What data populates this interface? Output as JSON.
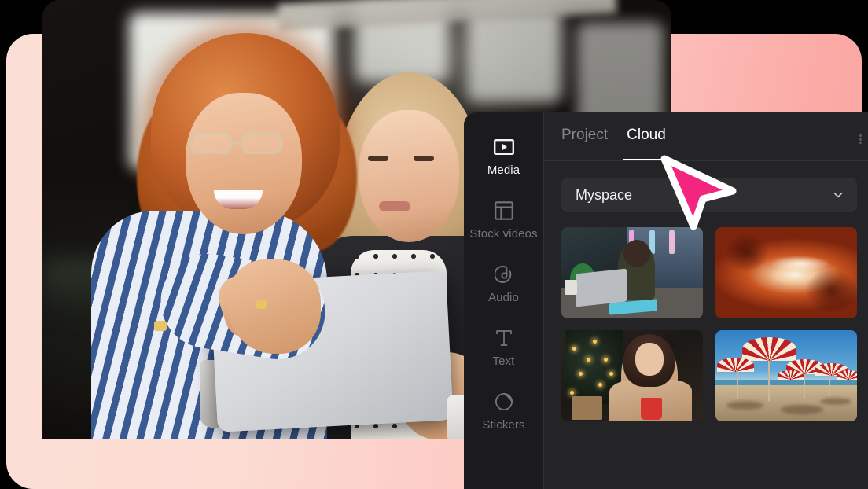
{
  "app": {
    "panel_title": "Media library panel"
  },
  "sidebar": {
    "items": [
      {
        "label": "Media",
        "icon": "media-play-rectangle-icon",
        "active": true
      },
      {
        "label": "Stock videos",
        "icon": "layout-grid-icon",
        "active": false
      },
      {
        "label": "Audio",
        "icon": "audio-note-circle-icon",
        "active": false
      },
      {
        "label": "Text",
        "icon": "text-serif-t-icon",
        "active": false
      },
      {
        "label": "Stickers",
        "icon": "sticker-circle-icon",
        "active": false
      }
    ]
  },
  "tabs": [
    {
      "label": "Project",
      "active": false
    },
    {
      "label": "Cloud",
      "active": true
    }
  ],
  "workspace_select": {
    "value": "Myspace",
    "chevron": "chevron-down-icon"
  },
  "media_grid": {
    "items": [
      {
        "alt": "Woman working on laptop by a window at night",
        "art": "t-laptop"
      },
      {
        "alt": "Red sandstone slot canyon",
        "art": "t-canyon"
      },
      {
        "alt": "Woman drinking by a Christmas tree",
        "art": "t-xmas"
      },
      {
        "alt": "Red and white beach umbrellas on sand",
        "art": "t-umbrella"
      }
    ]
  },
  "hero": {
    "alt": "Two women looking at a tablet in an office"
  },
  "cursor": {
    "type": "arrow-pointer",
    "color": "#f4257f"
  },
  "colors": {
    "backdrop_light": "#fbdfd6",
    "backdrop_dark": "#faa5a2",
    "panel_bg": "#242426",
    "rail_bg": "#1b1b1d",
    "select_bg": "#2f2f32",
    "accent_text": "#ffffff",
    "muted_text": "#86868b"
  }
}
